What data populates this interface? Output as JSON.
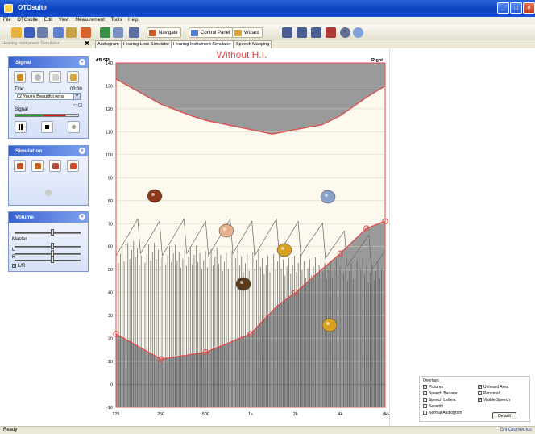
{
  "window": {
    "title": "OTOsuite"
  },
  "menu": [
    "File",
    "OTOsuite",
    "Edit",
    "View",
    "Measurement",
    "Tools",
    "Help"
  ],
  "toolbar": {
    "navigate": "Navigate",
    "control_panel": "Control Panel",
    "wizard": "Wizard"
  },
  "panel_title": "Hearing Instrument Simulator",
  "tabs": [
    "Audiogram",
    "Hearing Loss Simulator",
    "Hearing Instrument Simulator",
    "Speech Mapping"
  ],
  "signal": {
    "header": "Signal",
    "title_label": "Title:",
    "time": "03:30",
    "track": "02 You're Beautiful.wma",
    "signal_label": "Signal"
  },
  "simulation": {
    "header": "Simulation"
  },
  "volume": {
    "header": "Volume",
    "master": "Master",
    "left": "L",
    "right": "R",
    "lr": "L/R"
  },
  "chart": {
    "heading": "Without H.I.",
    "ylabel": "dB SPL",
    "side": "Right",
    "hz": "Hz"
  },
  "overlays": {
    "title": "Overlays",
    "items": [
      {
        "label": "Pictures",
        "checked": true
      },
      {
        "label": "Unheard Area",
        "checked": true
      },
      {
        "label": "Speech Banana",
        "checked": false
      },
      {
        "label": "Personal",
        "checked": false
      },
      {
        "label": "Speech Letters",
        "checked": false
      },
      {
        "label": "Visible Speech",
        "checked": true
      },
      {
        "label": "Severity",
        "checked": false
      },
      {
        "label": "Normal Audiogram",
        "checked": false
      }
    ],
    "default": "Default"
  },
  "status": {
    "left": "Ready",
    "right": "GN Otometrics"
  },
  "colors": {
    "accent": "#2a5fd6",
    "threshold": "#e04a4a",
    "unheard": "#9a9a9a"
  },
  "chart_data": {
    "type": "line",
    "title": "Without H.I.",
    "ylabel": "dB SPL",
    "ylim": [
      -10,
      140
    ],
    "yticks": [
      -10,
      0,
      10,
      20,
      30,
      40,
      50,
      60,
      70,
      80,
      90,
      100,
      110,
      120,
      130,
      140
    ],
    "x_freqs": [
      125,
      250,
      500,
      1000,
      2000,
      4000,
      8000
    ],
    "x_labels": [
      "125",
      "250",
      "500",
      "1k",
      "2k",
      "4k",
      "8k"
    ],
    "series": [
      {
        "role": "hearing-threshold",
        "points": [
          [
            125,
            22
          ],
          [
            250,
            11
          ],
          [
            500,
            14
          ],
          [
            1000,
            22
          ],
          [
            1500,
            34
          ],
          [
            2000,
            40
          ],
          [
            3000,
            50
          ],
          [
            4000,
            57
          ],
          [
            6000,
            68
          ],
          [
            8000,
            71
          ]
        ]
      },
      {
        "role": "uncomfortable-level",
        "points": [
          [
            125,
            133
          ],
          [
            250,
            122
          ],
          [
            400,
            117
          ],
          [
            500,
            115
          ],
          [
            700,
            113
          ],
          [
            1000,
            111
          ],
          [
            1400,
            109
          ],
          [
            2000,
            111
          ],
          [
            3000,
            113
          ],
          [
            4000,
            117
          ],
          [
            6000,
            125
          ],
          [
            8000,
            130
          ]
        ]
      }
    ],
    "grid": true
  }
}
